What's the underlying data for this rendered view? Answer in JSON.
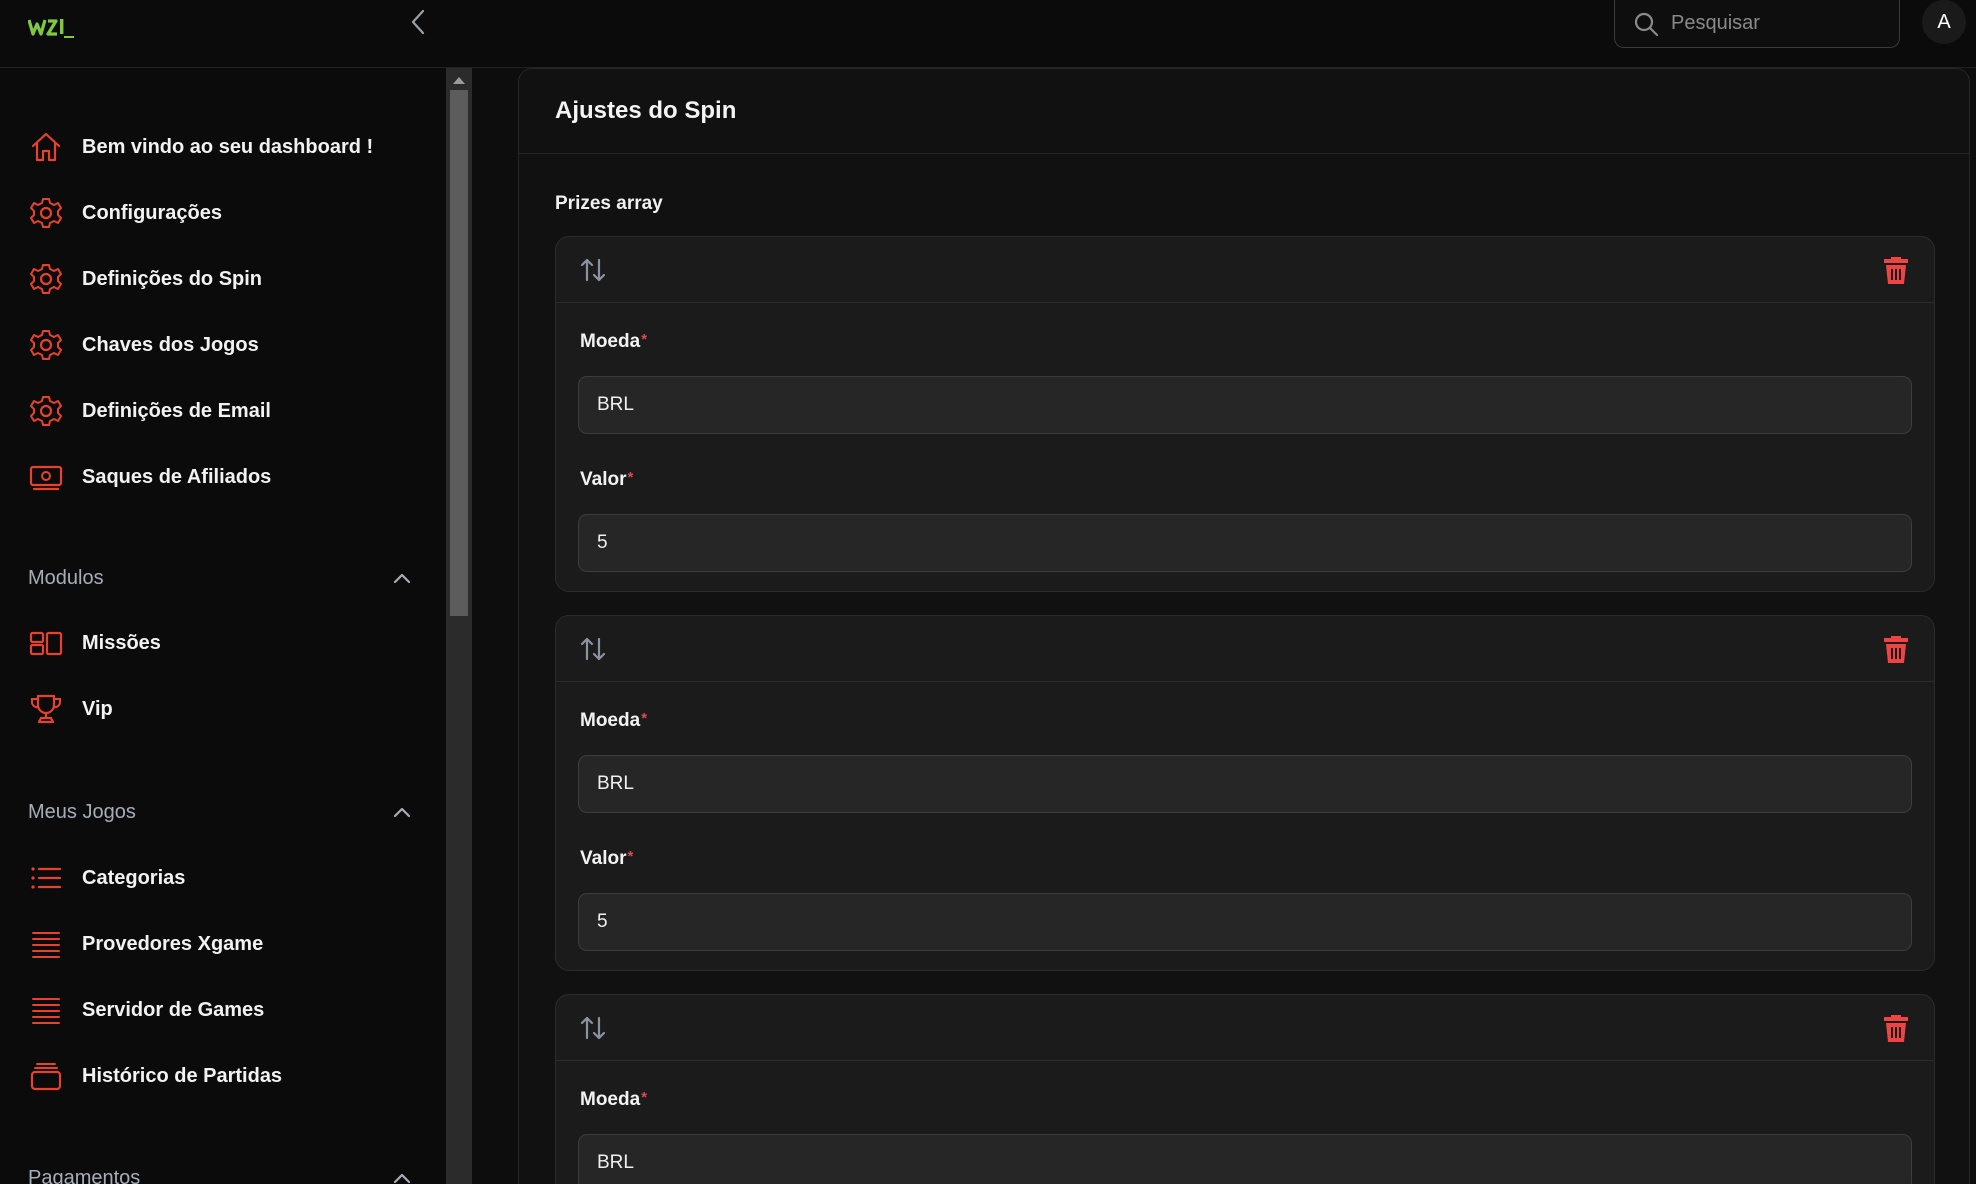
{
  "header": {
    "search_placeholder": "Pesquisar",
    "avatar_initial": "A"
  },
  "sidebar": {
    "items": [
      {
        "label": "Bem vindo ao seu dashboard !",
        "icon": "home-icon"
      },
      {
        "label": "Configurações",
        "icon": "gear-icon"
      },
      {
        "label": "Definições do Spin",
        "icon": "gear-icon"
      },
      {
        "label": "Chaves dos Jogos",
        "icon": "gear-icon"
      },
      {
        "label": "Definições de Email",
        "icon": "gear-icon"
      },
      {
        "label": "Saques de Afiliados",
        "icon": "money-icon"
      }
    ],
    "groups": [
      {
        "label": "Modulos",
        "items": [
          {
            "label": "Missões",
            "icon": "layout-icon"
          },
          {
            "label": "Vip",
            "icon": "trophy-icon"
          }
        ]
      },
      {
        "label": "Meus Jogos",
        "items": [
          {
            "label": "Categorias",
            "icon": "list-icon"
          },
          {
            "label": "Provedores Xgame",
            "icon": "lines-icon"
          },
          {
            "label": "Servidor de Games",
            "icon": "lines-icon"
          },
          {
            "label": "Histórico de Partidas",
            "icon": "stack-icon"
          }
        ]
      },
      {
        "label": "Pagamentos"
      }
    ]
  },
  "main": {
    "title": "Ajustes do Spin",
    "section_label": "Prizes array",
    "cards": [
      {
        "moeda_label": "Moeda",
        "moeda_value": "BRL",
        "valor_label": "Valor",
        "valor_value": "5"
      },
      {
        "moeda_label": "Moeda",
        "moeda_value": "BRL",
        "valor_label": "Valor",
        "valor_value": "5"
      },
      {
        "moeda_label": "Moeda",
        "moeda_value": "BRL"
      }
    ],
    "required_mark": "*"
  },
  "colors": {
    "accent": "#e8412c",
    "logo_green": "#7ec93f",
    "background": "#0d0d0d",
    "card": "#1b1b1b",
    "trash": "#ef4444"
  }
}
